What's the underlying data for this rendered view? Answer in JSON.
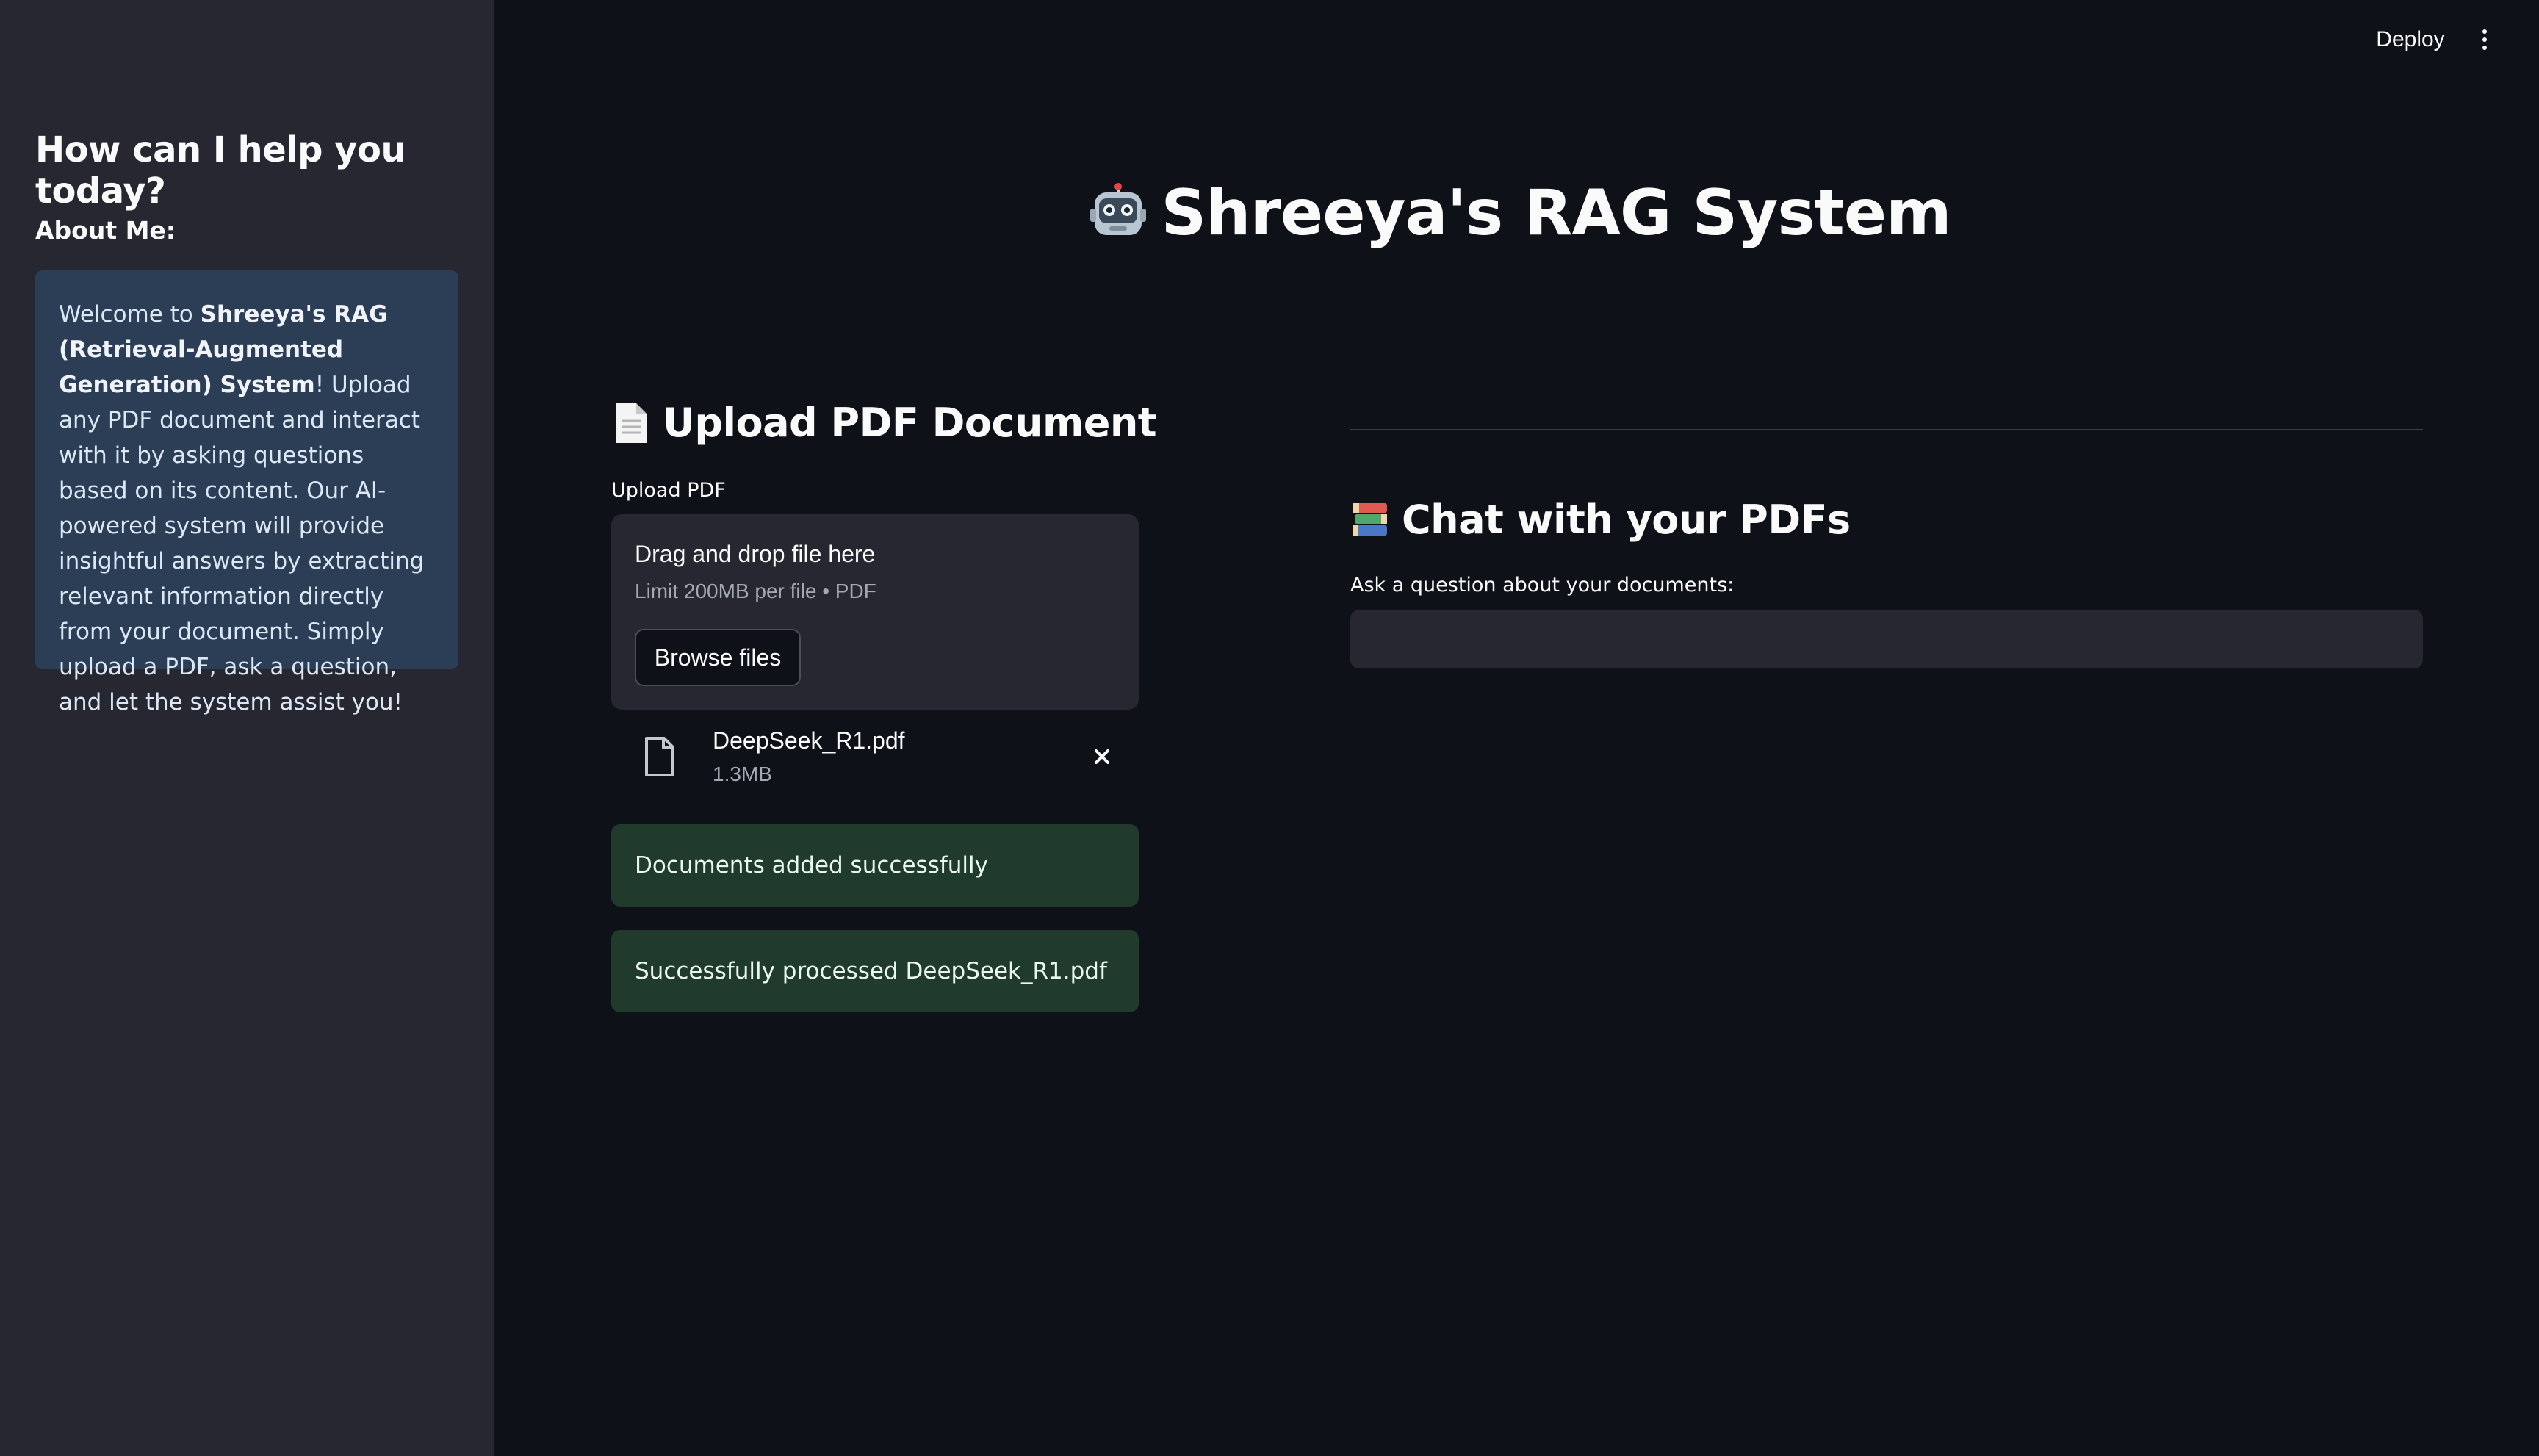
{
  "sidebar": {
    "title": "How can I help you today?",
    "about_heading": "About Me:",
    "about_text": {
      "intro": "Welcome to ",
      "system_name": "Shreeya's RAG (Retrieval-Augmented Generation) System",
      "after_name": "! Upload any PDF document and interact with it by asking questions based on its content. Our AI-powered system will provide insightful answers by extracting relevant information directly from your document. Simply upload a PDF, ask a question, and let the system assist you!"
    }
  },
  "toolbar": {
    "deploy_label": "Deploy",
    "menu_icon": "more-vertical-icon"
  },
  "main": {
    "title": "Shreeya's RAG System",
    "title_icon": "robot-icon"
  },
  "upload": {
    "heading": "Upload PDF Document",
    "heading_icon": "document-icon",
    "field_label": "Upload PDF",
    "dropzone_title": "Drag and drop file here",
    "dropzone_limit": "Limit 200MB per file • PDF",
    "browse_label": "Browse files",
    "file": {
      "name": "DeepSeek_R1.pdf",
      "size": "1.3MB",
      "icon": "file-icon",
      "remove_icon": "close-icon"
    },
    "alerts": [
      "Documents added successfully",
      "Successfully processed DeepSeek_R1.pdf"
    ]
  },
  "chat": {
    "heading": "Chat with your PDFs",
    "heading_icon": "books-icon",
    "field_label": "Ask a question about your documents:",
    "input_value": ""
  },
  "colors": {
    "background": "#0e1117",
    "sidebar": "#262730",
    "info_box": "#2c3e56",
    "success_box": "#203a2b"
  }
}
